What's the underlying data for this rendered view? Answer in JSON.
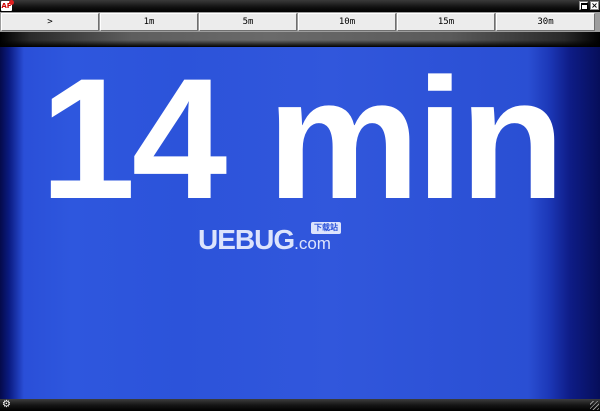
{
  "titlebar": {
    "app_icon_text": "AF",
    "restore_icon": "restore-icon",
    "close_glyph": "×"
  },
  "toolbar": {
    "buttons": [
      {
        "label": ">",
        "name": "start"
      },
      {
        "label": "1m",
        "name": "1m"
      },
      {
        "label": "5m",
        "name": "5m"
      },
      {
        "label": "10m",
        "name": "10m"
      },
      {
        "label": "15m",
        "name": "15m"
      },
      {
        "label": "30m",
        "name": "30m"
      }
    ]
  },
  "timer": {
    "display": "14 min"
  },
  "watermark": {
    "brand": "UEBUG",
    "domain": ".com",
    "badge": "下载站"
  },
  "statusbar": {
    "settings_glyph": "⚙"
  },
  "colors": {
    "panel_blue": "#2e57de",
    "panel_edge": "#060e5a",
    "toolbar_face": "#ececec",
    "timer_text": "#ffffff"
  }
}
